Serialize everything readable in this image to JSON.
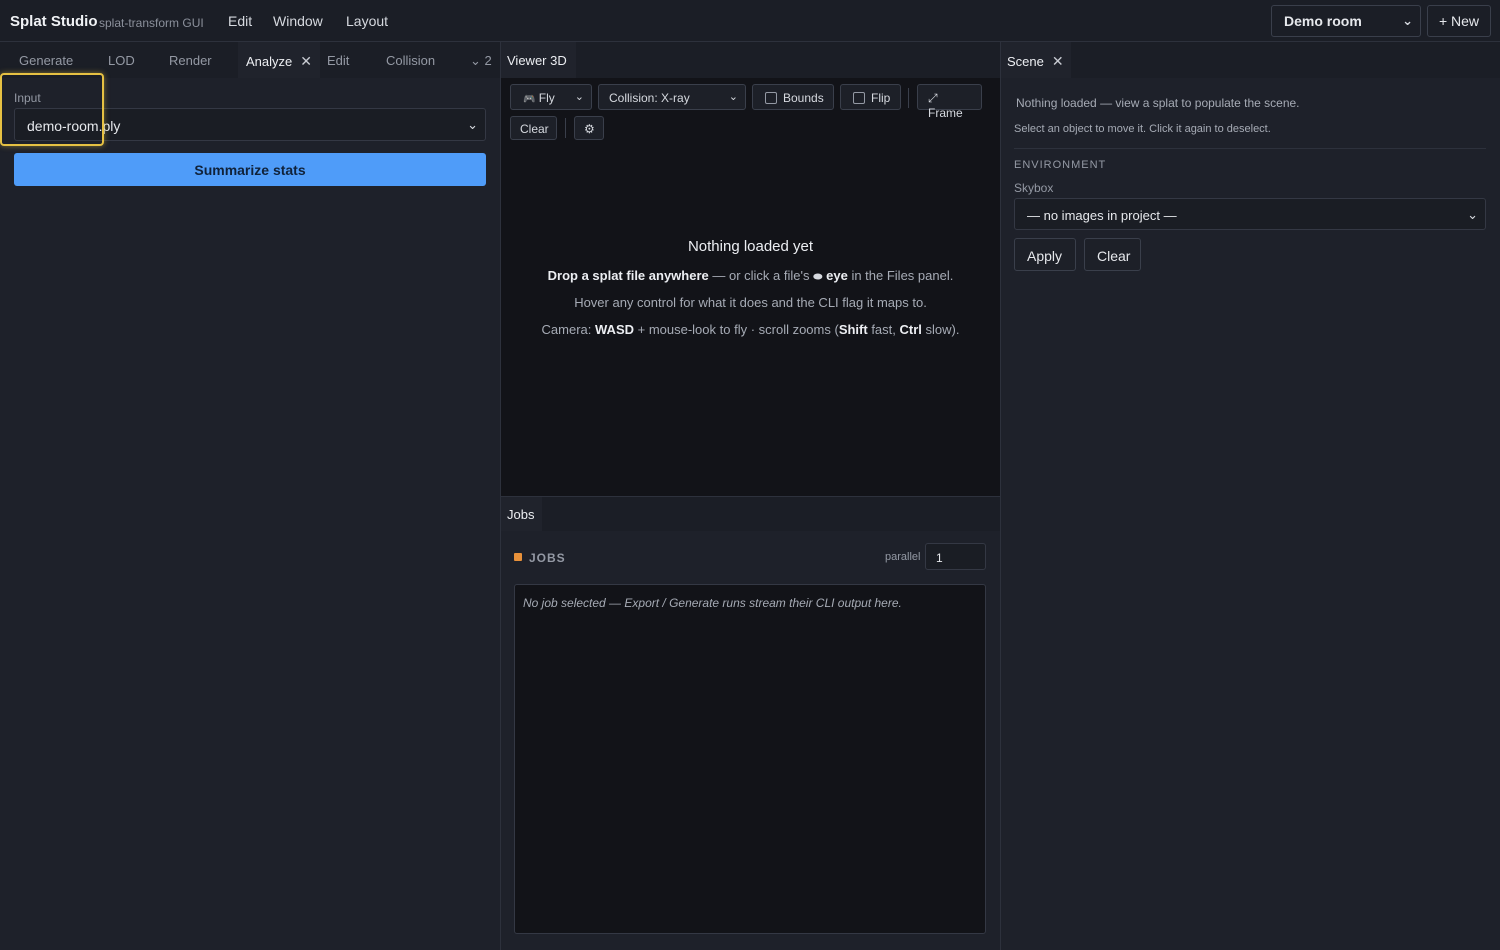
{
  "app": {
    "name": "Splat Studio",
    "subtitle": "splat-transform GUI"
  },
  "menu": {
    "items": [
      "Edit",
      "Window",
      "Layout"
    ]
  },
  "project": {
    "selected": "Demo room",
    "new_label": "+ New"
  },
  "left_panel": {
    "tabs": [
      "Generate",
      "LOD",
      "Render",
      "Analyze",
      "Edit",
      "Collision"
    ],
    "active_tab": "Analyze",
    "overflow_count": "2",
    "input_label": "Input",
    "input_value": "demo-room.ply",
    "summarize_label": "Summarize stats"
  },
  "viewer": {
    "tab_label": "Viewer 3D",
    "mode_label": "Fly",
    "collision_label": "Collision: X-ray",
    "bounds_label": "Bounds",
    "flip_label": "Flip",
    "frame_label": "⤢ Frame",
    "clear_label": "Clear",
    "settings_icon": "⚙",
    "empty_title": "Nothing loaded yet",
    "line1_bold": "Drop a splat file anywhere",
    "line1_mid": " — or click a file's ",
    "line1_eye": "eye",
    "line1_end": " in the Files panel.",
    "line2": "Hover any control for what it does and the CLI flag it maps to.",
    "line3_pre": "Camera: ",
    "line3_wasd": "WASD",
    "line3_mid": " + mouse-look to fly · scroll zooms (",
    "line3_shift": "Shift",
    "line3_mid2": " fast, ",
    "line3_ctrl": "Ctrl",
    "line3_end": " slow)."
  },
  "jobs": {
    "tab_label": "Jobs",
    "heading": "JOBS",
    "parallel_label": "parallel",
    "parallel_value": "1",
    "log_placeholder": "No job selected — Export / Generate runs stream their CLI output here."
  },
  "scene": {
    "tab_label": "Scene",
    "message1": "Nothing loaded — view a splat to populate the scene.",
    "message2": "Select an object to move it. Click it again to deselect.",
    "env_heading": "ENVIRONMENT",
    "skybox_label": "Skybox",
    "skybox_value": "— no images in project —",
    "apply_label": "Apply",
    "clear_label": "Clear"
  },
  "colors": {
    "accent": "#4f9cf9",
    "focus_ring": "#e6c143",
    "jobs_dot": "#e8913a"
  }
}
